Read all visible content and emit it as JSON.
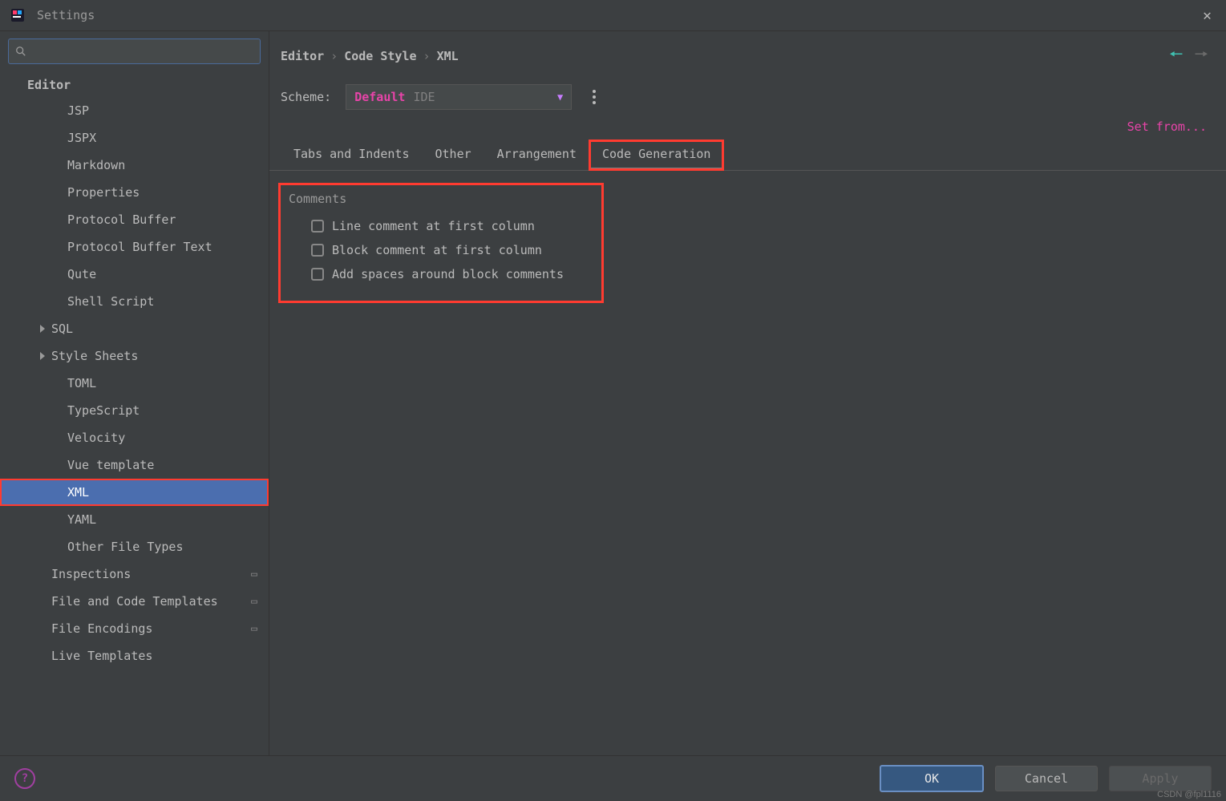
{
  "window": {
    "title": "Settings"
  },
  "search": {
    "placeholder": ""
  },
  "sidebar": {
    "heading": "Editor",
    "items": [
      {
        "label": "JSP",
        "level": 3,
        "expandable": false,
        "selected": false
      },
      {
        "label": "JSPX",
        "level": 3,
        "expandable": false,
        "selected": false
      },
      {
        "label": "Markdown",
        "level": 3,
        "expandable": false,
        "selected": false
      },
      {
        "label": "Properties",
        "level": 3,
        "expandable": false,
        "selected": false
      },
      {
        "label": "Protocol Buffer",
        "level": 3,
        "expandable": false,
        "selected": false
      },
      {
        "label": "Protocol Buffer Text",
        "level": 3,
        "expandable": false,
        "selected": false
      },
      {
        "label": "Qute",
        "level": 3,
        "expandable": false,
        "selected": false
      },
      {
        "label": "Shell Script",
        "level": 3,
        "expandable": false,
        "selected": false
      },
      {
        "label": "SQL",
        "level": 3,
        "expandable": true,
        "selected": false
      },
      {
        "label": "Style Sheets",
        "level": 3,
        "expandable": true,
        "selected": false
      },
      {
        "label": "TOML",
        "level": 3,
        "expandable": false,
        "selected": false
      },
      {
        "label": "TypeScript",
        "level": 3,
        "expandable": false,
        "selected": false
      },
      {
        "label": "Velocity",
        "level": 3,
        "expandable": false,
        "selected": false
      },
      {
        "label": "Vue template",
        "level": 3,
        "expandable": false,
        "selected": false
      },
      {
        "label": "XML",
        "level": 3,
        "expandable": false,
        "selected": true
      },
      {
        "label": "YAML",
        "level": 3,
        "expandable": false,
        "selected": false
      },
      {
        "label": "Other File Types",
        "level": 3,
        "expandable": false,
        "selected": false
      },
      {
        "label": "Inspections",
        "level": 1,
        "expandable": false,
        "selected": false,
        "note": true
      },
      {
        "label": "File and Code Templates",
        "level": 1,
        "expandable": false,
        "selected": false,
        "note": true
      },
      {
        "label": "File Encodings",
        "level": 1,
        "expandable": false,
        "selected": false,
        "note": true
      },
      {
        "label": "Live Templates",
        "level": 1,
        "expandable": false,
        "selected": false
      }
    ]
  },
  "breadcrumbs": {
    "a": "Editor",
    "b": "Code Style",
    "c": "XML",
    "sep": "›"
  },
  "scheme": {
    "label": "Scheme:",
    "value": "Default",
    "tag": "IDE"
  },
  "set_from": "Set from...",
  "tabs": {
    "items": [
      {
        "label": "Tabs and Indents",
        "active": false
      },
      {
        "label": "Other",
        "active": false
      },
      {
        "label": "Arrangement",
        "active": false
      },
      {
        "label": "Code Generation",
        "active": true
      }
    ]
  },
  "comments": {
    "heading": "Comments",
    "items": [
      {
        "label": "Line comment at first column",
        "checked": false
      },
      {
        "label": "Block comment at first column",
        "checked": false
      },
      {
        "label": "Add spaces around block comments",
        "checked": false
      }
    ]
  },
  "buttons": {
    "ok": "OK",
    "cancel": "Cancel",
    "apply": "Apply"
  },
  "watermark": "CSDN @fpl1116"
}
